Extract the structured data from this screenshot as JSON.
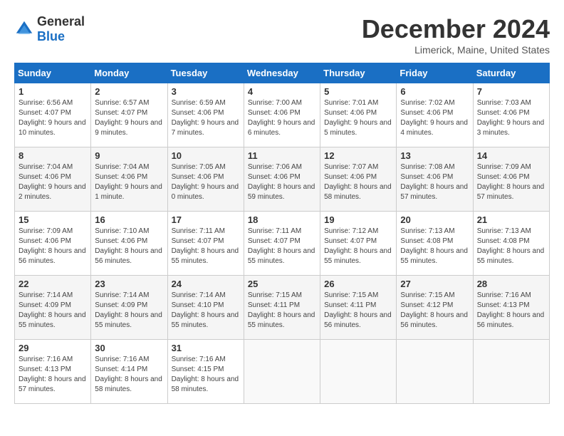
{
  "logo": {
    "general": "General",
    "blue": "Blue"
  },
  "title": "December 2024",
  "location": "Limerick, Maine, United States",
  "weekdays": [
    "Sunday",
    "Monday",
    "Tuesday",
    "Wednesday",
    "Thursday",
    "Friday",
    "Saturday"
  ],
  "weeks": [
    [
      {
        "day": "1",
        "sunrise": "6:56 AM",
        "sunset": "4:07 PM",
        "daylight": "9 hours and 10 minutes."
      },
      {
        "day": "2",
        "sunrise": "6:57 AM",
        "sunset": "4:07 PM",
        "daylight": "9 hours and 9 minutes."
      },
      {
        "day": "3",
        "sunrise": "6:59 AM",
        "sunset": "4:06 PM",
        "daylight": "9 hours and 7 minutes."
      },
      {
        "day": "4",
        "sunrise": "7:00 AM",
        "sunset": "4:06 PM",
        "daylight": "9 hours and 6 minutes."
      },
      {
        "day": "5",
        "sunrise": "7:01 AM",
        "sunset": "4:06 PM",
        "daylight": "9 hours and 5 minutes."
      },
      {
        "day": "6",
        "sunrise": "7:02 AM",
        "sunset": "4:06 PM",
        "daylight": "9 hours and 4 minutes."
      },
      {
        "day": "7",
        "sunrise": "7:03 AM",
        "sunset": "4:06 PM",
        "daylight": "9 hours and 3 minutes."
      }
    ],
    [
      {
        "day": "8",
        "sunrise": "7:04 AM",
        "sunset": "4:06 PM",
        "daylight": "9 hours and 2 minutes."
      },
      {
        "day": "9",
        "sunrise": "7:04 AM",
        "sunset": "4:06 PM",
        "daylight": "9 hours and 1 minute."
      },
      {
        "day": "10",
        "sunrise": "7:05 AM",
        "sunset": "4:06 PM",
        "daylight": "9 hours and 0 minutes."
      },
      {
        "day": "11",
        "sunrise": "7:06 AM",
        "sunset": "4:06 PM",
        "daylight": "8 hours and 59 minutes."
      },
      {
        "day": "12",
        "sunrise": "7:07 AM",
        "sunset": "4:06 PM",
        "daylight": "8 hours and 58 minutes."
      },
      {
        "day": "13",
        "sunrise": "7:08 AM",
        "sunset": "4:06 PM",
        "daylight": "8 hours and 57 minutes."
      },
      {
        "day": "14",
        "sunrise": "7:09 AM",
        "sunset": "4:06 PM",
        "daylight": "8 hours and 57 minutes."
      }
    ],
    [
      {
        "day": "15",
        "sunrise": "7:09 AM",
        "sunset": "4:06 PM",
        "daylight": "8 hours and 56 minutes."
      },
      {
        "day": "16",
        "sunrise": "7:10 AM",
        "sunset": "4:06 PM",
        "daylight": "8 hours and 56 minutes."
      },
      {
        "day": "17",
        "sunrise": "7:11 AM",
        "sunset": "4:07 PM",
        "daylight": "8 hours and 55 minutes."
      },
      {
        "day": "18",
        "sunrise": "7:11 AM",
        "sunset": "4:07 PM",
        "daylight": "8 hours and 55 minutes."
      },
      {
        "day": "19",
        "sunrise": "7:12 AM",
        "sunset": "4:07 PM",
        "daylight": "8 hours and 55 minutes."
      },
      {
        "day": "20",
        "sunrise": "7:13 AM",
        "sunset": "4:08 PM",
        "daylight": "8 hours and 55 minutes."
      },
      {
        "day": "21",
        "sunrise": "7:13 AM",
        "sunset": "4:08 PM",
        "daylight": "8 hours and 55 minutes."
      }
    ],
    [
      {
        "day": "22",
        "sunrise": "7:14 AM",
        "sunset": "4:09 PM",
        "daylight": "8 hours and 55 minutes."
      },
      {
        "day": "23",
        "sunrise": "7:14 AM",
        "sunset": "4:09 PM",
        "daylight": "8 hours and 55 minutes."
      },
      {
        "day": "24",
        "sunrise": "7:14 AM",
        "sunset": "4:10 PM",
        "daylight": "8 hours and 55 minutes."
      },
      {
        "day": "25",
        "sunrise": "7:15 AM",
        "sunset": "4:11 PM",
        "daylight": "8 hours and 55 minutes."
      },
      {
        "day": "26",
        "sunrise": "7:15 AM",
        "sunset": "4:11 PM",
        "daylight": "8 hours and 56 minutes."
      },
      {
        "day": "27",
        "sunrise": "7:15 AM",
        "sunset": "4:12 PM",
        "daylight": "8 hours and 56 minutes."
      },
      {
        "day": "28",
        "sunrise": "7:16 AM",
        "sunset": "4:13 PM",
        "daylight": "8 hours and 56 minutes."
      }
    ],
    [
      {
        "day": "29",
        "sunrise": "7:16 AM",
        "sunset": "4:13 PM",
        "daylight": "8 hours and 57 minutes."
      },
      {
        "day": "30",
        "sunrise": "7:16 AM",
        "sunset": "4:14 PM",
        "daylight": "8 hours and 58 minutes."
      },
      {
        "day": "31",
        "sunrise": "7:16 AM",
        "sunset": "4:15 PM",
        "daylight": "8 hours and 58 minutes."
      },
      null,
      null,
      null,
      null
    ]
  ],
  "labels": {
    "sunrise": "Sunrise:",
    "sunset": "Sunset:",
    "daylight": "Daylight hours"
  }
}
